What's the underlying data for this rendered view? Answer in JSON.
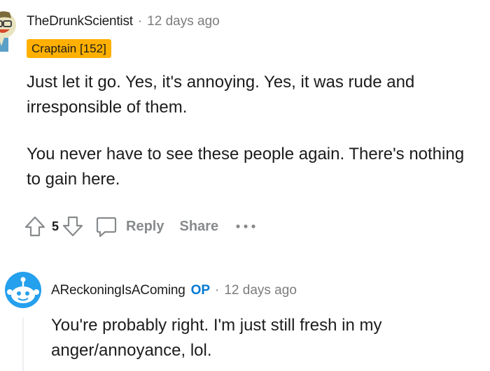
{
  "comment": {
    "author": "TheDrunkScientist",
    "separator": "·",
    "time": "12 days ago",
    "flair": "Craptain [152]",
    "paragraph1": "Just let it go. Yes, it's annoying. Yes, it was rude and irresponsible of them.",
    "paragraph2": "You never have to see these people again. There's nothing to gain here.",
    "score": "5",
    "reply_label": "Reply",
    "share_label": "Share",
    "icons": [
      "upvote-icon",
      "downvote-icon",
      "comment-icon",
      "more-icon"
    ],
    "flair_color": "#ffb000"
  },
  "reply": {
    "author": "AReckoningIsAComing",
    "op_badge": "OP",
    "separator": "·",
    "time": "12 days ago",
    "text": "You're probably right. I'm just still fresh in my anger/annoyance, lol.",
    "op_color": "#0079d3"
  }
}
